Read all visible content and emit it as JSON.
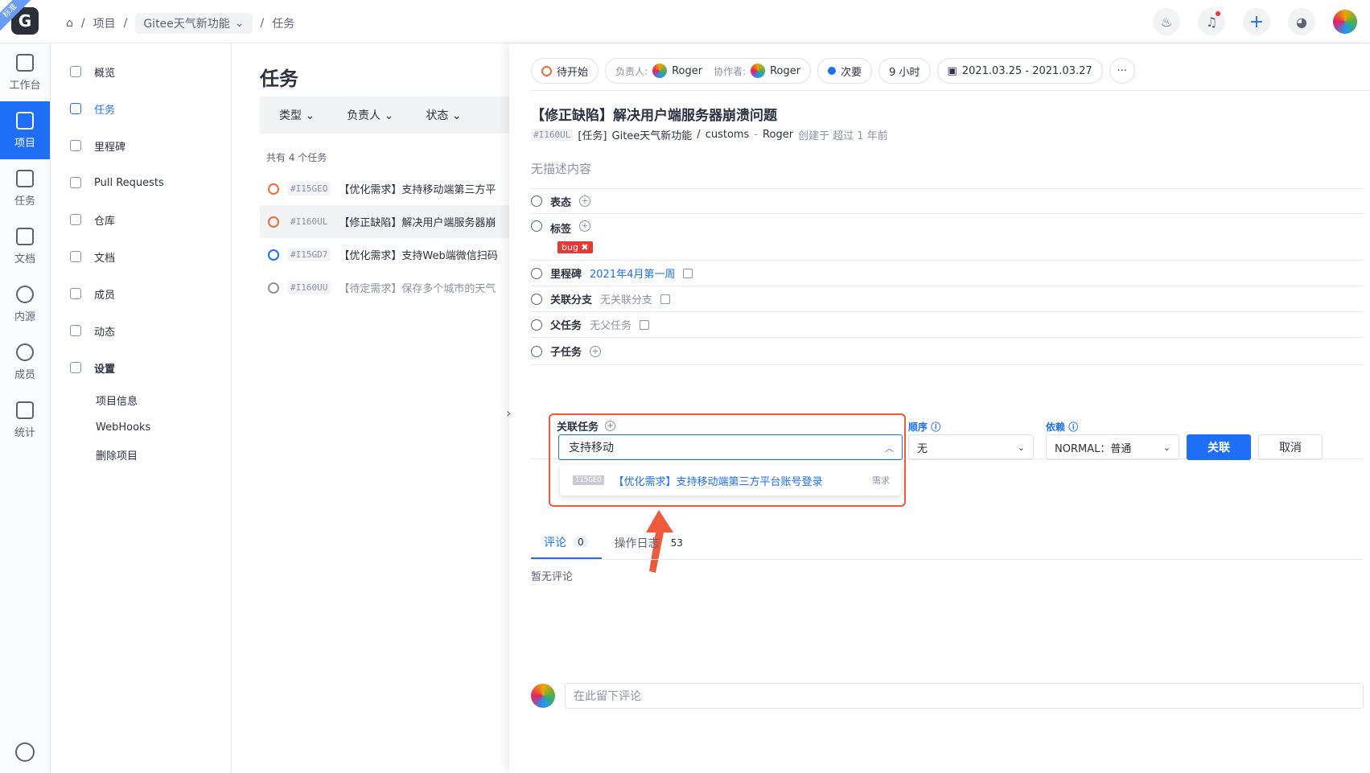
{
  "brand": {
    "logo": "G",
    "edition_badge": "标准"
  },
  "breadcrumb": {
    "items": [
      "项目",
      "Gitee天气新功能",
      "任务"
    ]
  },
  "sidebar": {
    "items": [
      "工作台",
      "项目",
      "任务",
      "文档",
      "内源",
      "成员",
      "统计"
    ],
    "active": "项目"
  },
  "project_nav": {
    "items": [
      "概览",
      "任务",
      "里程碑",
      "Pull Requests",
      "仓库",
      "文档",
      "成员",
      "动态",
      "设置"
    ],
    "active": "任务",
    "settings_sub": [
      "项目信息",
      "WebHooks",
      "删除项目"
    ]
  },
  "task_list": {
    "title": "任务",
    "filters": [
      "类型",
      "负责人",
      "状态"
    ],
    "count_text": "共有 4 个任务",
    "rows": [
      {
        "id": "#I15GEO",
        "title": "【优化需求】支持移动端第三方平",
        "status": "pending"
      },
      {
        "id": "#I160UL",
        "title": "【修正缺陷】解决用户端服务器崩",
        "status": "pending"
      },
      {
        "id": "#I15GD7",
        "title": "【优化需求】支持Web端微信扫码",
        "status": "in-progress"
      },
      {
        "id": "#I160UU",
        "title": "【待定需求】保存多个城市的天气",
        "status": "done"
      }
    ]
  },
  "detail": {
    "status": "待开始",
    "assignee_label": "负责人:",
    "assignee": "Roger",
    "collaborator_label": "协作者:",
    "collaborator": "Roger",
    "priority": "次要",
    "estimate": "9 小时",
    "date_range": "2021.03.25 - 2021.03.27",
    "title": "【修正缺陷】解决用户端服务器崩溃问题",
    "meta": {
      "id": "#I160UL",
      "type": "[任务]",
      "project": "Gitee天气新功能",
      "sep1": "/",
      "repo": "customs",
      "sep2": "-",
      "author": "Roger",
      "created": "创建于 超过 1 年前"
    },
    "description": "无描述内容",
    "fields": {
      "mood": "表态",
      "tags": "标签",
      "tag_value": "bug",
      "milestone": "里程碑",
      "milestone_value": "2021年4月第一周",
      "branch": "关联分支",
      "branch_value": "无关联分支",
      "parent": "父任务",
      "parent_value": "无父任务",
      "children": "子任务",
      "related": "关联任务"
    },
    "relate_form": {
      "search_value": "支持移动",
      "suggestion": {
        "id": "I15GEO",
        "title": "【优化需求】支持移动端第三方平台账号登录",
        "kind": "需求"
      },
      "order_label": "顺序",
      "order_value": "无",
      "dep_label": "依赖",
      "dep_value": "NORMAL：普通",
      "confirm": "关联",
      "cancel": "取消"
    },
    "tabs": [
      {
        "label": "评论",
        "count": "0"
      },
      {
        "label": "操作日志",
        "count": "53"
      }
    ],
    "no_comment": "暂无评论",
    "comment_placeholder": "在此留下评论"
  },
  "colors": {
    "accent": "#1e6ff5",
    "highlight": "#f05a3c",
    "bug": "#e53935"
  }
}
